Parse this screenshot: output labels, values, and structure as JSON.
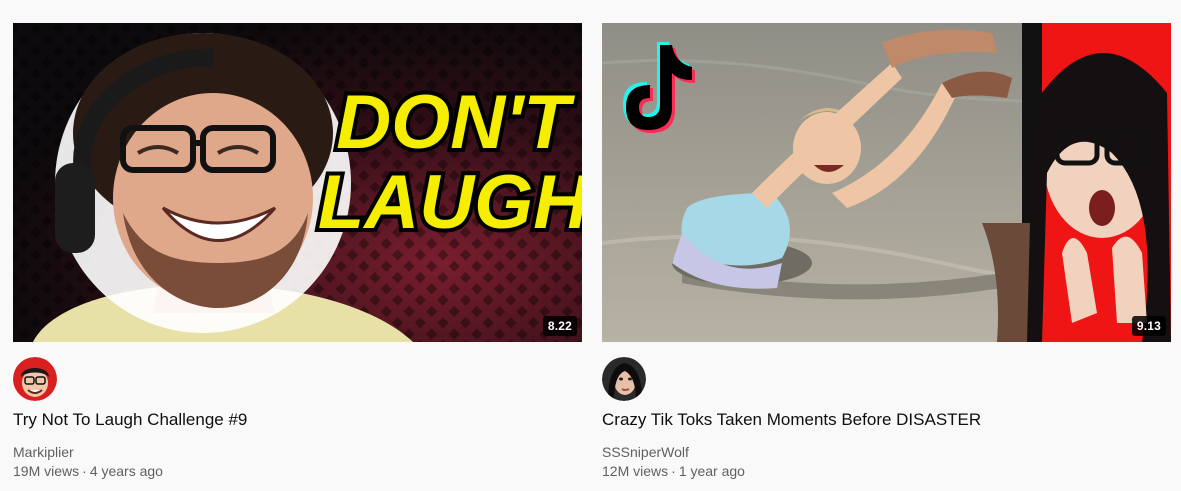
{
  "videos": [
    {
      "thumbnail_text": [
        "DON'T",
        "LAUGH"
      ],
      "duration": "8.22",
      "title": "Try Not To Laugh Challenge #9",
      "channel": "Markiplier",
      "views": "19M views",
      "separator": "·",
      "age": "4 years ago",
      "accent_color": "#f5ee00",
      "avatar_bg": "#d92020"
    },
    {
      "duration": "9.13",
      "title": "Crazy Tik Toks Taken Moments Before DISASTER",
      "channel": "SSSniperWolf",
      "views": "12M views",
      "separator": "·",
      "age": "1 year ago",
      "accent_color": "#ff0000",
      "avatar_bg": "#2a2a2a"
    }
  ],
  "icons": {
    "tiktok": "tiktok-logo-icon"
  }
}
